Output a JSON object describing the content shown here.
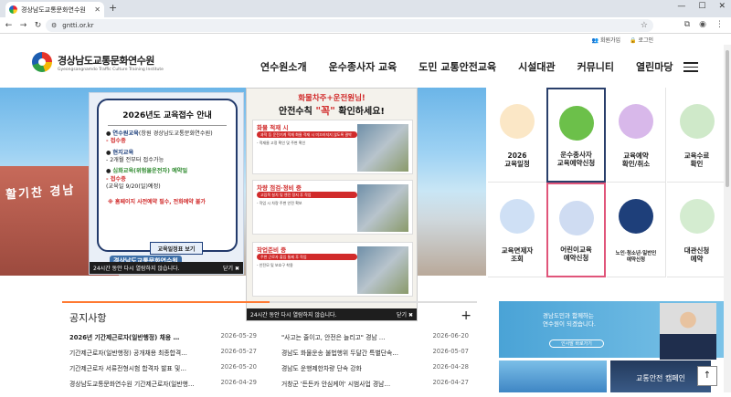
{
  "browser": {
    "tab_title": "경상남도교통문화연수원",
    "url": "gntti.or.kr"
  },
  "topbar": {
    "join": "회원가입",
    "login": "로그인"
  },
  "header": {
    "logo_ko": "경상남도교통문화연수원",
    "logo_en": "Gyeongsangnamdo Traffic Culture Training Institute",
    "nav": [
      "연수원소개",
      "운수종사자 교육",
      "도민 교통안전교육",
      "시설대관",
      "커뮤니티",
      "열린마당"
    ]
  },
  "hero": {
    "sign": "활기찬 경남"
  },
  "popup1": {
    "title": "2026년도 교육접수 안내",
    "items": [
      {
        "head": "연수원교육",
        "desc": "(창원 경상남도교통문화연수원)",
        "sub": "- 접수중"
      },
      {
        "head": "현지교육",
        "desc": "",
        "sub": "- 2개월 전부터 접수가능"
      },
      {
        "head": "심화교육(위험물운전자) 예약일",
        "desc": "",
        "sub": "- 접수중",
        "sub2": "(교육일 9/20(일)예정)"
      }
    ],
    "warn": "※ 홈페이지 사전예약 필수, 전화예약 불가",
    "button": "교육일정표 보기",
    "logo": "경상남도교통문화연수원",
    "footer": "24시간 동안 다시 열람하지 않습니다.",
    "close": "닫기 ✖"
  },
  "popup2": {
    "title1": "화물차주+운전원님!",
    "title2a": "안전수칙 ",
    "title2b": "\"꼭\"",
    "title2c": " 확인하세요!",
    "sections": [
      {
        "head": "화물 적재 시",
        "bar": "과적 등 운전기계 적재 화물 적재 시 미끄러지지 않도록 결박",
        "txt": "- 적재물 고정 확인 및 주변 확인"
      },
      {
        "head": "차량 점검·정비 중",
        "bar": "고임목 설치 및 엔진 정지 후 작업",
        "txt": "- 작업 시 차량 주변 안전 확보"
      },
      {
        "head": "작업준비 중",
        "bar": "주변 근로자 출입 통제 후 작업",
        "txt": "- 안전모 및 보호구 착용"
      }
    ],
    "footer": "24시간 동안 다시 열람하지 않습니다.",
    "close": "닫기 ✖"
  },
  "quick": [
    {
      "label": "2026\n교육일정",
      "icon": "calendar-icon",
      "color": "#f2a93b"
    },
    {
      "label": "운수종사자\n교육예약신청",
      "icon": "pencil-icon",
      "color": "#6cc04a"
    },
    {
      "label": "교육예약\n확인/취소",
      "icon": "magnifier-icon",
      "color": "#a25dc6"
    },
    {
      "label": "교육수료\n확인",
      "icon": "certificate-icon",
      "color": "#4cae4c"
    },
    {
      "label": "교육면제자\n조회",
      "icon": "monitor-icon",
      "color": "#2f7bd1"
    },
    {
      "label": "어린이교육\n예약신청",
      "icon": "pencil-icon",
      "color": "#2d6fc2"
    },
    {
      "label": "노인·청소년·일반인\n예약신청",
      "icon": "person-icon",
      "color": "#1e3f7a"
    },
    {
      "label": "대관신청\n예약",
      "icon": "board-icon",
      "color": "#4cae4c"
    }
  ],
  "notice": {
    "title": "공지사항",
    "left": [
      {
        "t": "2026년 기간제근로자(일반행정) 채용 …",
        "d": "2026-05-29"
      },
      {
        "t": "기간제근로자(일반행정) 공개채용 최종합격…",
        "d": "2026-05-27"
      },
      {
        "t": "기간제근로자 서류전형시험 합격자 발표 및…",
        "d": "2026-05-20"
      },
      {
        "t": "경상남도교통문화연수원 기간제근로자(일반행…",
        "d": "2026-04-29"
      }
    ],
    "right": [
      {
        "t": "\"사고는 줄이고, 안전은 늘리고\" 경남 …",
        "d": "2026-06-20"
      },
      {
        "t": "경남도 화물운송 불법행위 두달간 특별단속…",
        "d": "2026-05-07"
      },
      {
        "t": "경남도 운행제한차량 단속 강화",
        "d": "2026-04-28"
      },
      {
        "t": "거창군 '든든카 안심케어' 시범사업 경남…",
        "d": "2026-04-27"
      }
    ]
  },
  "side": {
    "banner_text": "경남도민과 함께하는\n연수원이 되겠습니다.",
    "banner_btn": "인사말 바로가기",
    "campaign": "교통안전 캠페인"
  }
}
